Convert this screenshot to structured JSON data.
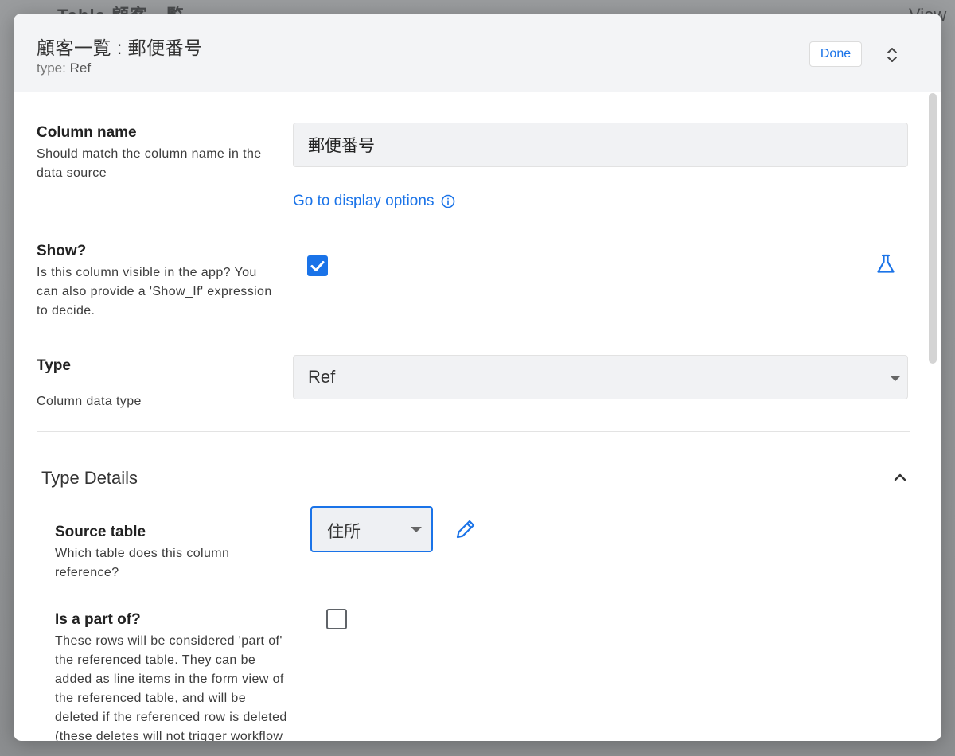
{
  "background": {
    "left_text": "Table 顧客一覧",
    "right_text": "View"
  },
  "header": {
    "title": "顧客一覧 : 郵便番号",
    "type_label": "type:",
    "type_value": "Ref",
    "done_label": "Done",
    "expand_icon": "chevron-up-down-icon"
  },
  "column_name": {
    "title": "Column name",
    "description": "Should match the column name in the data source",
    "value": "郵便番号",
    "display_link": "Go to display options",
    "info_icon": "info-circle-icon"
  },
  "show": {
    "title": "Show?",
    "description": "Is this column visible in the app? You can also provide a 'Show_If' expression to decide.",
    "checked": true,
    "expression_icon": "flask-icon"
  },
  "type": {
    "title": "Type",
    "description": "Column data type",
    "value": "Ref"
  },
  "type_details": {
    "title": "Type Details",
    "collapse_icon": "chevron-up-icon",
    "source_table": {
      "title": "Source table",
      "description": "Which table does this column reference?",
      "value": "住所",
      "edit_icon": "pencil-icon"
    },
    "part_of": {
      "title": "Is a part of?",
      "description": "These rows will be considered 'part of' the referenced table. They can be added as line items in the form view of the referenced table, and will be deleted if the referenced row is deleted (these deletes will not trigger workflow rules)",
      "checked": false
    }
  },
  "colors": {
    "accent": "#1a73e8",
    "header_bg": "#f3f4f6",
    "field_bg": "#f1f2f4"
  }
}
